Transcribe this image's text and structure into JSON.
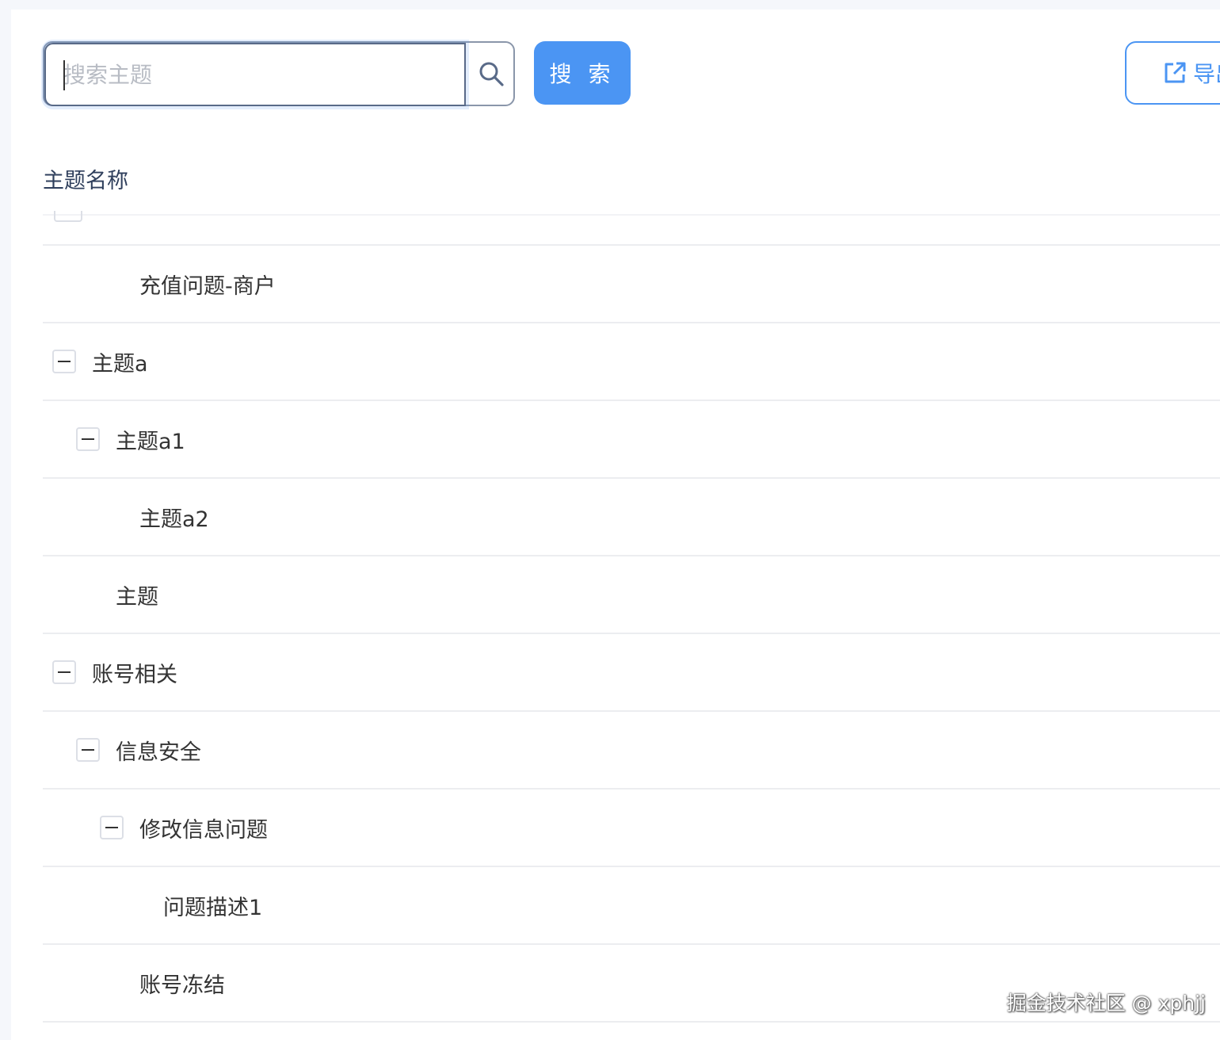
{
  "search": {
    "placeholder": "搜索主题",
    "button_label": "搜 索"
  },
  "toolbar": {
    "export_label": "导出"
  },
  "table": {
    "header": "主题名称",
    "rows": [
      {
        "label": "充值问题-商户",
        "level": 2,
        "expandable": false
      },
      {
        "label": "主题a",
        "level": 0,
        "expandable": true,
        "expanded": true
      },
      {
        "label": "主题a1",
        "level": 1,
        "expandable": true,
        "expanded": true
      },
      {
        "label": "主题a2",
        "level": 2,
        "expandable": false
      },
      {
        "label": "主题",
        "level": 1,
        "expandable": false
      },
      {
        "label": "账号相关",
        "level": 0,
        "expandable": true,
        "expanded": true
      },
      {
        "label": "信息安全",
        "level": 1,
        "expandable": true,
        "expanded": true
      },
      {
        "label": "修改信息问题",
        "level": 2,
        "expandable": true,
        "expanded": true
      },
      {
        "label": "问题描述1",
        "level": 3,
        "expandable": false
      },
      {
        "label": "账号冻结",
        "level": 2,
        "expandable": false
      }
    ]
  },
  "watermark": "掘金技术社区 @ xphjj",
  "colors": {
    "primary": "#4b95f3",
    "border": "#ecedf0",
    "header_text": "#2f3f5c"
  }
}
